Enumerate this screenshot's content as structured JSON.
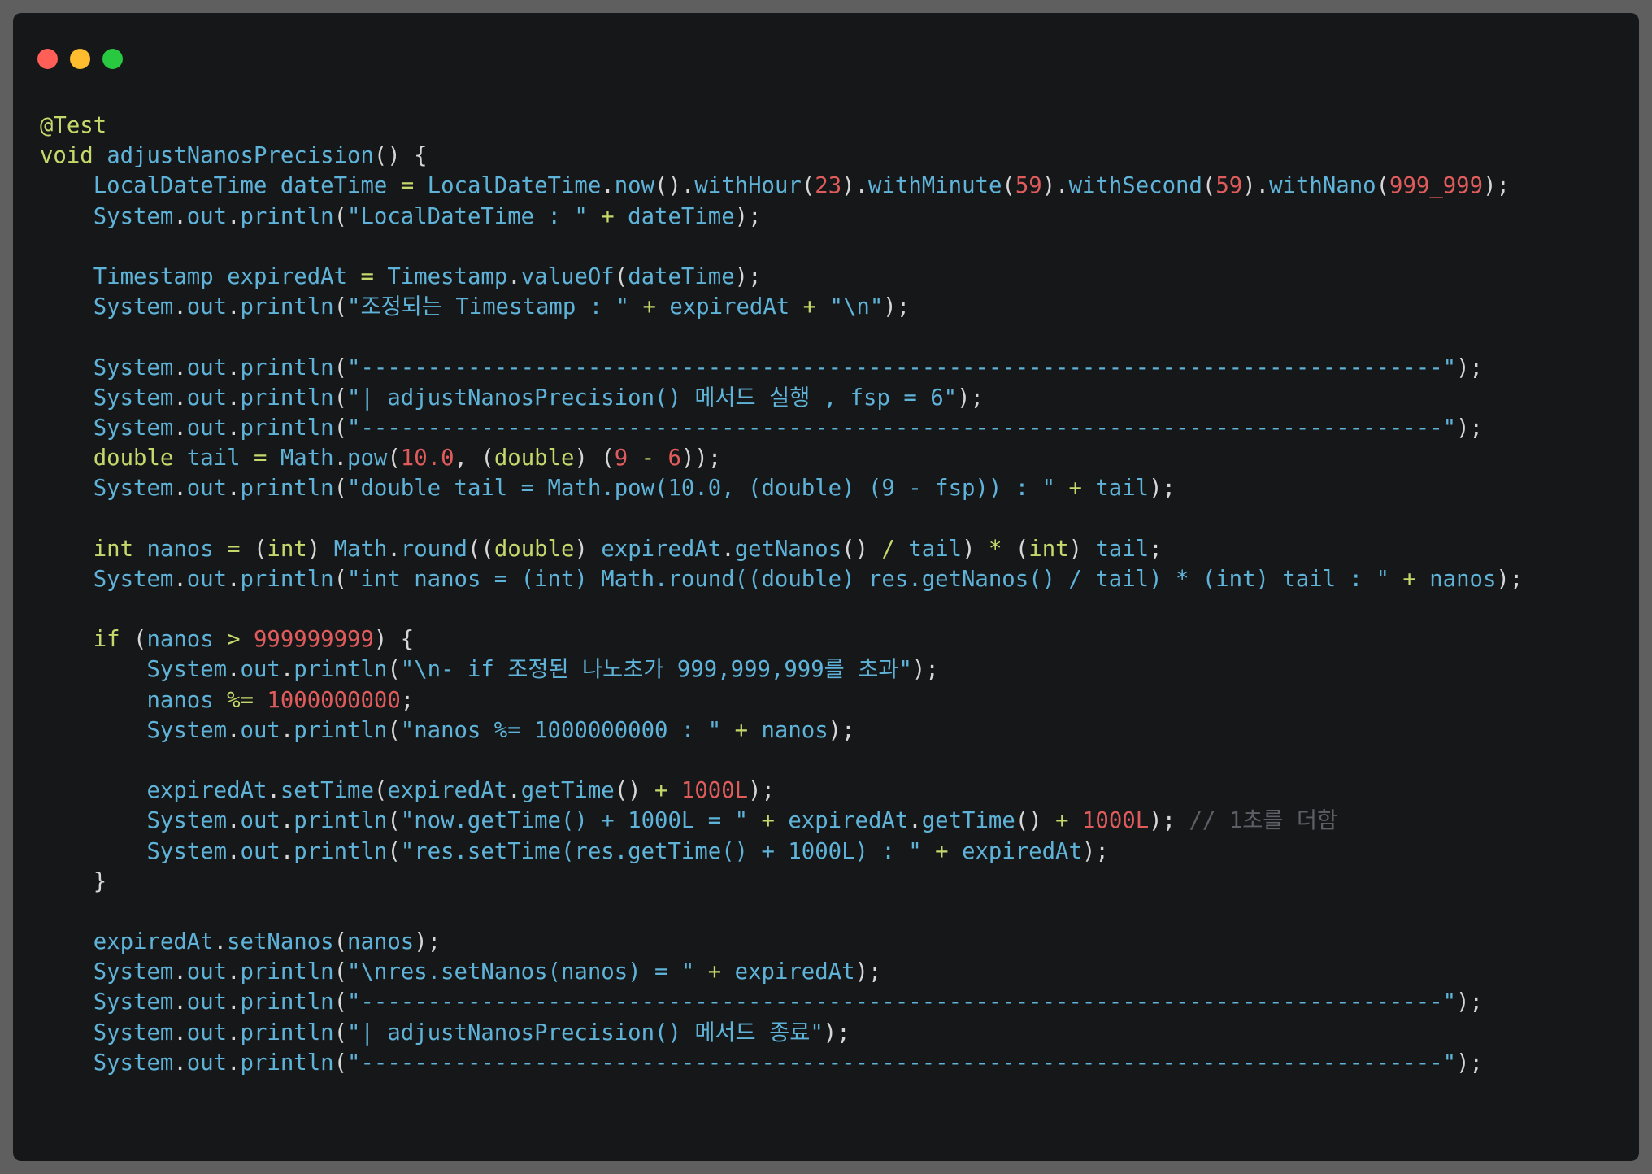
{
  "window": {
    "buttons": [
      {
        "name": "close",
        "color": "#ff5f57"
      },
      {
        "name": "minimize",
        "color": "#febc2e"
      },
      {
        "name": "maximize",
        "color": "#28c840"
      }
    ]
  },
  "colors": {
    "background": "#151719",
    "identifier": "#5fb3d8",
    "keyword": "#c3d96b",
    "number": "#e05c5c",
    "punctuation": "#d6d6d6",
    "comment": "#5c6066"
  },
  "code_lines": [
    [
      [
        "annot",
        "@Test"
      ]
    ],
    [
      [
        "kw",
        "void"
      ],
      [
        "punc",
        " "
      ],
      [
        "id",
        "adjustNanosPrecision"
      ],
      [
        "punc",
        "() {"
      ]
    ],
    [
      [
        "punc",
        "    "
      ],
      [
        "ty",
        "LocalDateTime"
      ],
      [
        "punc",
        " "
      ],
      [
        "id",
        "dateTime"
      ],
      [
        "punc",
        " "
      ],
      [
        "op",
        "="
      ],
      [
        "punc",
        " "
      ],
      [
        "ty",
        "LocalDateTime"
      ],
      [
        "punc",
        "."
      ],
      [
        "id",
        "now"
      ],
      [
        "punc",
        "()."
      ],
      [
        "id",
        "withHour"
      ],
      [
        "punc",
        "("
      ],
      [
        "num",
        "23"
      ],
      [
        "punc",
        ")."
      ],
      [
        "id",
        "withMinute"
      ],
      [
        "punc",
        "("
      ],
      [
        "num",
        "59"
      ],
      [
        "punc",
        ")."
      ],
      [
        "id",
        "withSecond"
      ],
      [
        "punc",
        "("
      ],
      [
        "num",
        "59"
      ],
      [
        "punc",
        ")."
      ],
      [
        "id",
        "withNano"
      ],
      [
        "punc",
        "("
      ],
      [
        "num",
        "999_999"
      ],
      [
        "punc",
        ");"
      ]
    ],
    [
      [
        "punc",
        "    "
      ],
      [
        "ty",
        "System"
      ],
      [
        "punc",
        "."
      ],
      [
        "id",
        "out"
      ],
      [
        "punc",
        "."
      ],
      [
        "id",
        "println"
      ],
      [
        "punc",
        "("
      ],
      [
        "str",
        "\"LocalDateTime : \""
      ],
      [
        "punc",
        " "
      ],
      [
        "op",
        "+"
      ],
      [
        "punc",
        " "
      ],
      [
        "id",
        "dateTime"
      ],
      [
        "punc",
        ");"
      ]
    ],
    [],
    [
      [
        "punc",
        "    "
      ],
      [
        "ty",
        "Timestamp"
      ],
      [
        "punc",
        " "
      ],
      [
        "id",
        "expiredAt"
      ],
      [
        "punc",
        " "
      ],
      [
        "op",
        "="
      ],
      [
        "punc",
        " "
      ],
      [
        "ty",
        "Timestamp"
      ],
      [
        "punc",
        "."
      ],
      [
        "id",
        "valueOf"
      ],
      [
        "punc",
        "("
      ],
      [
        "id",
        "dateTime"
      ],
      [
        "punc",
        ");"
      ]
    ],
    [
      [
        "punc",
        "    "
      ],
      [
        "ty",
        "System"
      ],
      [
        "punc",
        "."
      ],
      [
        "id",
        "out"
      ],
      [
        "punc",
        "."
      ],
      [
        "id",
        "println"
      ],
      [
        "punc",
        "("
      ],
      [
        "str",
        "\"조정되는 Timestamp : \""
      ],
      [
        "punc",
        " "
      ],
      [
        "op",
        "+"
      ],
      [
        "punc",
        " "
      ],
      [
        "id",
        "expiredAt"
      ],
      [
        "punc",
        " "
      ],
      [
        "op",
        "+"
      ],
      [
        "punc",
        " "
      ],
      [
        "str",
        "\"\\n\""
      ],
      [
        "punc",
        ");"
      ]
    ],
    [],
    [
      [
        "punc",
        "    "
      ],
      [
        "ty",
        "System"
      ],
      [
        "punc",
        "."
      ],
      [
        "id",
        "out"
      ],
      [
        "punc",
        "."
      ],
      [
        "id",
        "println"
      ],
      [
        "punc",
        "("
      ],
      [
        "str",
        "\"---------------------------------------------------------------------------------\""
      ],
      [
        "punc",
        ");"
      ]
    ],
    [
      [
        "punc",
        "    "
      ],
      [
        "ty",
        "System"
      ],
      [
        "punc",
        "."
      ],
      [
        "id",
        "out"
      ],
      [
        "punc",
        "."
      ],
      [
        "id",
        "println"
      ],
      [
        "punc",
        "("
      ],
      [
        "str",
        "\"| adjustNanosPrecision() 메서드 실행 , fsp = 6\""
      ],
      [
        "punc",
        ");"
      ]
    ],
    [
      [
        "punc",
        "    "
      ],
      [
        "ty",
        "System"
      ],
      [
        "punc",
        "."
      ],
      [
        "id",
        "out"
      ],
      [
        "punc",
        "."
      ],
      [
        "id",
        "println"
      ],
      [
        "punc",
        "("
      ],
      [
        "str",
        "\"---------------------------------------------------------------------------------\""
      ],
      [
        "punc",
        ");"
      ]
    ],
    [
      [
        "punc",
        "    "
      ],
      [
        "kw",
        "double"
      ],
      [
        "punc",
        " "
      ],
      [
        "id",
        "tail"
      ],
      [
        "punc",
        " "
      ],
      [
        "op",
        "="
      ],
      [
        "punc",
        " "
      ],
      [
        "ty",
        "Math"
      ],
      [
        "punc",
        "."
      ],
      [
        "id",
        "pow"
      ],
      [
        "punc",
        "("
      ],
      [
        "num",
        "10.0"
      ],
      [
        "punc",
        ", ("
      ],
      [
        "kw",
        "double"
      ],
      [
        "punc",
        ") ("
      ],
      [
        "num",
        "9"
      ],
      [
        "punc",
        " "
      ],
      [
        "op",
        "-"
      ],
      [
        "punc",
        " "
      ],
      [
        "num",
        "6"
      ],
      [
        "punc",
        "));"
      ]
    ],
    [
      [
        "punc",
        "    "
      ],
      [
        "ty",
        "System"
      ],
      [
        "punc",
        "."
      ],
      [
        "id",
        "out"
      ],
      [
        "punc",
        "."
      ],
      [
        "id",
        "println"
      ],
      [
        "punc",
        "("
      ],
      [
        "str",
        "\"double tail = Math.pow(10.0, (double) (9 - fsp)) : \""
      ],
      [
        "punc",
        " "
      ],
      [
        "op",
        "+"
      ],
      [
        "punc",
        " "
      ],
      [
        "id",
        "tail"
      ],
      [
        "punc",
        ");"
      ]
    ],
    [],
    [
      [
        "punc",
        "    "
      ],
      [
        "kw",
        "int"
      ],
      [
        "punc",
        " "
      ],
      [
        "id",
        "nanos"
      ],
      [
        "punc",
        " "
      ],
      [
        "op",
        "="
      ],
      [
        "punc",
        " ("
      ],
      [
        "kw",
        "int"
      ],
      [
        "punc",
        ") "
      ],
      [
        "ty",
        "Math"
      ],
      [
        "punc",
        "."
      ],
      [
        "id",
        "round"
      ],
      [
        "punc",
        "(("
      ],
      [
        "kw",
        "double"
      ],
      [
        "punc",
        ") "
      ],
      [
        "id",
        "expiredAt"
      ],
      [
        "punc",
        "."
      ],
      [
        "id",
        "getNanos"
      ],
      [
        "punc",
        "() "
      ],
      [
        "op",
        "/"
      ],
      [
        "punc",
        " "
      ],
      [
        "id",
        "tail"
      ],
      [
        "punc",
        ") "
      ],
      [
        "op",
        "*"
      ],
      [
        "punc",
        " ("
      ],
      [
        "kw",
        "int"
      ],
      [
        "punc",
        ") "
      ],
      [
        "id",
        "tail"
      ],
      [
        "punc",
        ";"
      ]
    ],
    [
      [
        "punc",
        "    "
      ],
      [
        "ty",
        "System"
      ],
      [
        "punc",
        "."
      ],
      [
        "id",
        "out"
      ],
      [
        "punc",
        "."
      ],
      [
        "id",
        "println"
      ],
      [
        "punc",
        "("
      ],
      [
        "str",
        "\"int nanos = (int) Math.round((double) res.getNanos() / tail) * (int) tail : \""
      ],
      [
        "punc",
        " "
      ],
      [
        "op",
        "+"
      ],
      [
        "punc",
        " "
      ],
      [
        "id",
        "nanos"
      ],
      [
        "punc",
        ");"
      ]
    ],
    [],
    [
      [
        "punc",
        "    "
      ],
      [
        "kw",
        "if"
      ],
      [
        "punc",
        " ("
      ],
      [
        "id",
        "nanos"
      ],
      [
        "punc",
        " "
      ],
      [
        "op",
        ">"
      ],
      [
        "punc",
        " "
      ],
      [
        "num",
        "999999999"
      ],
      [
        "punc",
        ") {"
      ]
    ],
    [
      [
        "punc",
        "        "
      ],
      [
        "ty",
        "System"
      ],
      [
        "punc",
        "."
      ],
      [
        "id",
        "out"
      ],
      [
        "punc",
        "."
      ],
      [
        "id",
        "println"
      ],
      [
        "punc",
        "("
      ],
      [
        "str",
        "\"\\n- if 조정된 나노초가 999,999,999를 초과\""
      ],
      [
        "punc",
        ");"
      ]
    ],
    [
      [
        "punc",
        "        "
      ],
      [
        "id",
        "nanos"
      ],
      [
        "punc",
        " "
      ],
      [
        "op",
        "%="
      ],
      [
        "punc",
        " "
      ],
      [
        "num",
        "1000000000"
      ],
      [
        "punc",
        ";"
      ]
    ],
    [
      [
        "punc",
        "        "
      ],
      [
        "ty",
        "System"
      ],
      [
        "punc",
        "."
      ],
      [
        "id",
        "out"
      ],
      [
        "punc",
        "."
      ],
      [
        "id",
        "println"
      ],
      [
        "punc",
        "("
      ],
      [
        "str",
        "\"nanos %= 1000000000 : \""
      ],
      [
        "punc",
        " "
      ],
      [
        "op",
        "+"
      ],
      [
        "punc",
        " "
      ],
      [
        "id",
        "nanos"
      ],
      [
        "punc",
        ");"
      ]
    ],
    [],
    [
      [
        "punc",
        "        "
      ],
      [
        "id",
        "expiredAt"
      ],
      [
        "punc",
        "."
      ],
      [
        "id",
        "setTime"
      ],
      [
        "punc",
        "("
      ],
      [
        "id",
        "expiredAt"
      ],
      [
        "punc",
        "."
      ],
      [
        "id",
        "getTime"
      ],
      [
        "punc",
        "() "
      ],
      [
        "op",
        "+"
      ],
      [
        "punc",
        " "
      ],
      [
        "num",
        "1000L"
      ],
      [
        "punc",
        ");"
      ]
    ],
    [
      [
        "punc",
        "        "
      ],
      [
        "ty",
        "System"
      ],
      [
        "punc",
        "."
      ],
      [
        "id",
        "out"
      ],
      [
        "punc",
        "."
      ],
      [
        "id",
        "println"
      ],
      [
        "punc",
        "("
      ],
      [
        "str",
        "\"now.getTime() + 1000L = \""
      ],
      [
        "punc",
        " "
      ],
      [
        "op",
        "+"
      ],
      [
        "punc",
        " "
      ],
      [
        "id",
        "expiredAt"
      ],
      [
        "punc",
        "."
      ],
      [
        "id",
        "getTime"
      ],
      [
        "punc",
        "() "
      ],
      [
        "op",
        "+"
      ],
      [
        "punc",
        " "
      ],
      [
        "num",
        "1000L"
      ],
      [
        "punc",
        "); "
      ],
      [
        "cmt",
        "// 1초를 더함"
      ]
    ],
    [
      [
        "punc",
        "        "
      ],
      [
        "ty",
        "System"
      ],
      [
        "punc",
        "."
      ],
      [
        "id",
        "out"
      ],
      [
        "punc",
        "."
      ],
      [
        "id",
        "println"
      ],
      [
        "punc",
        "("
      ],
      [
        "str",
        "\"res.setTime(res.getTime() + 1000L) : \""
      ],
      [
        "punc",
        " "
      ],
      [
        "op",
        "+"
      ],
      [
        "punc",
        " "
      ],
      [
        "id",
        "expiredAt"
      ],
      [
        "punc",
        ");"
      ]
    ],
    [
      [
        "punc",
        "    }"
      ]
    ],
    [],
    [
      [
        "punc",
        "    "
      ],
      [
        "id",
        "expiredAt"
      ],
      [
        "punc",
        "."
      ],
      [
        "id",
        "setNanos"
      ],
      [
        "punc",
        "("
      ],
      [
        "id",
        "nanos"
      ],
      [
        "punc",
        ");"
      ]
    ],
    [
      [
        "punc",
        "    "
      ],
      [
        "ty",
        "System"
      ],
      [
        "punc",
        "."
      ],
      [
        "id",
        "out"
      ],
      [
        "punc",
        "."
      ],
      [
        "id",
        "println"
      ],
      [
        "punc",
        "("
      ],
      [
        "str",
        "\"\\nres.setNanos(nanos) = \""
      ],
      [
        "punc",
        " "
      ],
      [
        "op",
        "+"
      ],
      [
        "punc",
        " "
      ],
      [
        "id",
        "expiredAt"
      ],
      [
        "punc",
        ");"
      ]
    ],
    [
      [
        "punc",
        "    "
      ],
      [
        "ty",
        "System"
      ],
      [
        "punc",
        "."
      ],
      [
        "id",
        "out"
      ],
      [
        "punc",
        "."
      ],
      [
        "id",
        "println"
      ],
      [
        "punc",
        "("
      ],
      [
        "str",
        "\"---------------------------------------------------------------------------------\""
      ],
      [
        "punc",
        ");"
      ]
    ],
    [
      [
        "punc",
        "    "
      ],
      [
        "ty",
        "System"
      ],
      [
        "punc",
        "."
      ],
      [
        "id",
        "out"
      ],
      [
        "punc",
        "."
      ],
      [
        "id",
        "println"
      ],
      [
        "punc",
        "("
      ],
      [
        "str",
        "\"| adjustNanosPrecision() 메서드 종료\""
      ],
      [
        "punc",
        ");"
      ]
    ],
    [
      [
        "punc",
        "    "
      ],
      [
        "ty",
        "System"
      ],
      [
        "punc",
        "."
      ],
      [
        "id",
        "out"
      ],
      [
        "punc",
        "."
      ],
      [
        "id",
        "println"
      ],
      [
        "punc",
        "("
      ],
      [
        "str",
        "\"---------------------------------------------------------------------------------\""
      ],
      [
        "punc",
        ");"
      ]
    ]
  ]
}
